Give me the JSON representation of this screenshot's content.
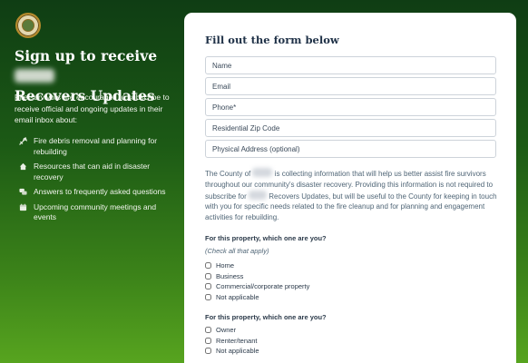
{
  "left_panel": {
    "headline_part1": "Sign up to receive",
    "headline_part2": "Recovers Updates",
    "intro": "Fire survivors are encouraged to subscribe to receive official and ongoing updates in their email inbox about:",
    "features": [
      {
        "icon": "wrench-icon",
        "label": "Fire debris removal and planning for rebuilding"
      },
      {
        "icon": "house-icon",
        "label": "Resources that can aid in disaster recovery"
      },
      {
        "icon": "chat-icon",
        "label": "Answers to frequently asked questions"
      },
      {
        "icon": "calendar-icon",
        "label": "Upcoming community meetings and events"
      }
    ]
  },
  "form": {
    "title": "Fill out the form below",
    "fields": [
      {
        "placeholder": "Name"
      },
      {
        "placeholder": "Email"
      },
      {
        "placeholder": "Phone*"
      },
      {
        "placeholder": "Residential Zip Code"
      },
      {
        "placeholder": "Physical Address (optional)"
      }
    ],
    "disclaimer": {
      "part1": "The County of",
      "part2": "is collecting information that will help us better assist fire survivors throughout our community's disaster recovery. Providing this information is not required to subscribe for",
      "part3": "Recovers Updates, but will be useful to the County for keeping in touch with you for specific needs related to the fire cleanup and for planning and engagement activities for rebuilding."
    },
    "question1": {
      "label": "For this property, which one are you?",
      "hint": "(Check all that apply)",
      "options": [
        "Home",
        "Business",
        "Commercial/corporate property",
        "Not applicable"
      ]
    },
    "question2": {
      "label": "For this property, which one are you?",
      "options": [
        "Owner",
        "Renter/tenant",
        "Not applicable"
      ]
    }
  }
}
